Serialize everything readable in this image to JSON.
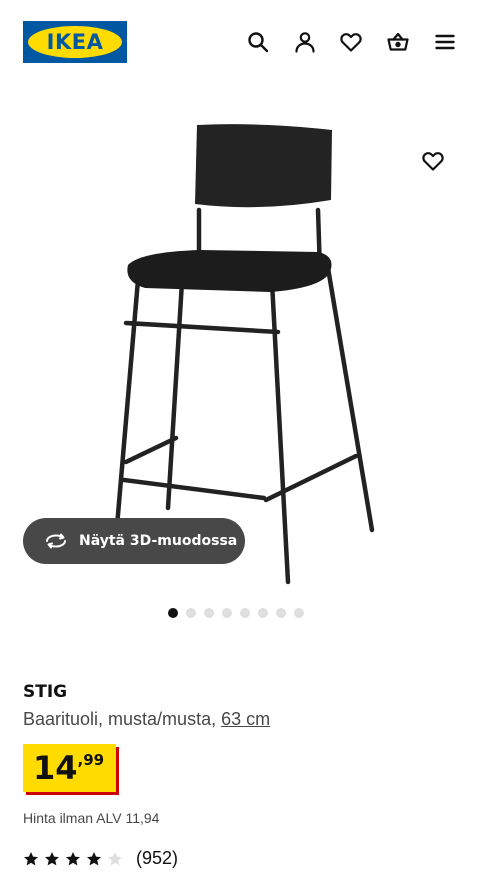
{
  "header": {
    "logo_text": "IKEA",
    "icons": [
      "search-icon",
      "account-icon",
      "favourites-icon",
      "basket-icon",
      "menu-icon"
    ]
  },
  "gallery": {
    "view_3d_label": "Näytä 3D-muodossa",
    "dots_total": 8,
    "active_dot": 1
  },
  "product": {
    "name": "STIG",
    "description": "Baarituoli, musta/musta,",
    "size": "63 cm",
    "price_integer": "14",
    "price_decimal": ",99",
    "vat_text": "Hinta ilman ALV 11,94",
    "rating": 4,
    "rating_max": 5,
    "review_count": "(952)"
  },
  "colors": {
    "brand_blue": "#0058a3",
    "brand_yellow": "#ffdb00",
    "price_shadow": "#cc0008",
    "button_dark": "#484848"
  }
}
